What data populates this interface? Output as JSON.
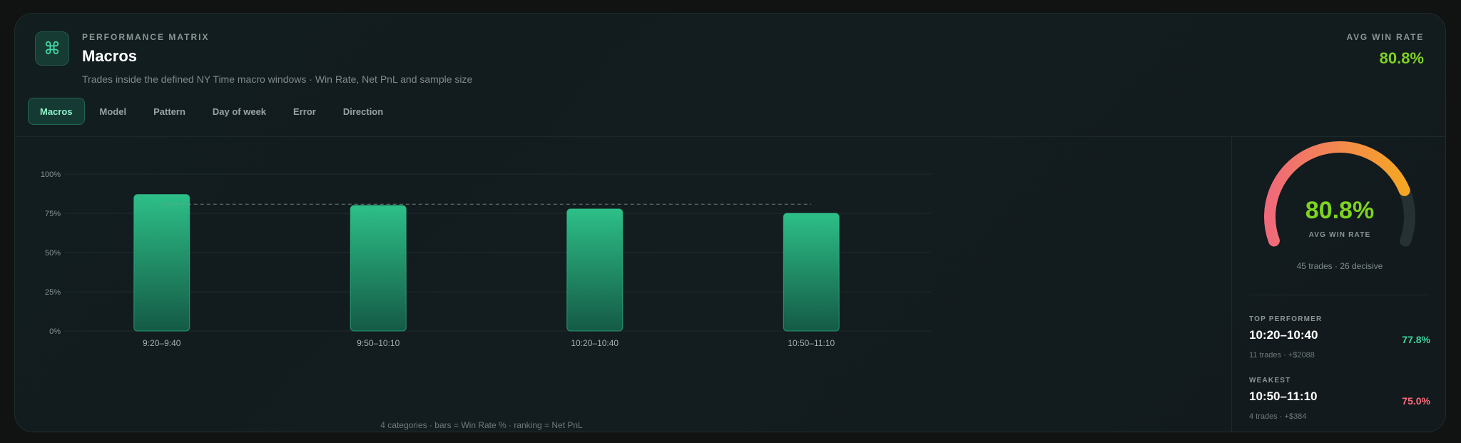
{
  "header": {
    "logo_icon": "command-icon",
    "logo_glyph": "⌘",
    "eyebrow": "PERFORMANCE MATRIX",
    "title": "Macros",
    "subtitle": "Trades inside the defined NY Time macro windows · Win Rate, Net PnL and sample size",
    "avg_label": "AVG WIN RATE",
    "avg_value": "80.8%"
  },
  "tabs": [
    {
      "label": "Macros",
      "active": true
    },
    {
      "label": "Model",
      "active": false
    },
    {
      "label": "Pattern",
      "active": false
    },
    {
      "label": "Day of week",
      "active": false
    },
    {
      "label": "Error",
      "active": false
    },
    {
      "label": "Direction",
      "active": false
    }
  ],
  "chart_data": {
    "type": "bar",
    "categories": [
      "9:20–9:40",
      "9:50–10:10",
      "10:20–10:40",
      "10:50–11:10"
    ],
    "values": [
      87,
      80,
      77.8,
      75
    ],
    "ylim": [
      0,
      100
    ],
    "yticks": [
      0,
      25,
      50,
      75,
      100
    ],
    "ytick_labels": [
      "0%",
      "25%",
      "50%",
      "75%",
      "100%"
    ],
    "reference_line": 80.8,
    "grid": true,
    "footer": "4 categories · bars = Win Rate % · ranking = Net PnL"
  },
  "gauge": {
    "value_pct": 80.8,
    "value_text": "80.8%",
    "label": "AVG WIN RATE",
    "footer": "45 trades · 26 decisive"
  },
  "top": {
    "label": "TOP PERFORMER",
    "name": "10:20–10:40",
    "meta": "11 trades · +$2088",
    "pct": "77.8%"
  },
  "weakest": {
    "label": "WEAKEST",
    "name": "10:50–11:10",
    "meta": "4 trades · +$384",
    "pct": "75.0%"
  },
  "colors": {
    "accent": "#2dbf88",
    "win_rate": "#7ed321",
    "top": "#3fd6a0",
    "weak": "#ff6b7a",
    "gauge_start": "#f06a7a",
    "gauge_end": "#f5a623"
  }
}
